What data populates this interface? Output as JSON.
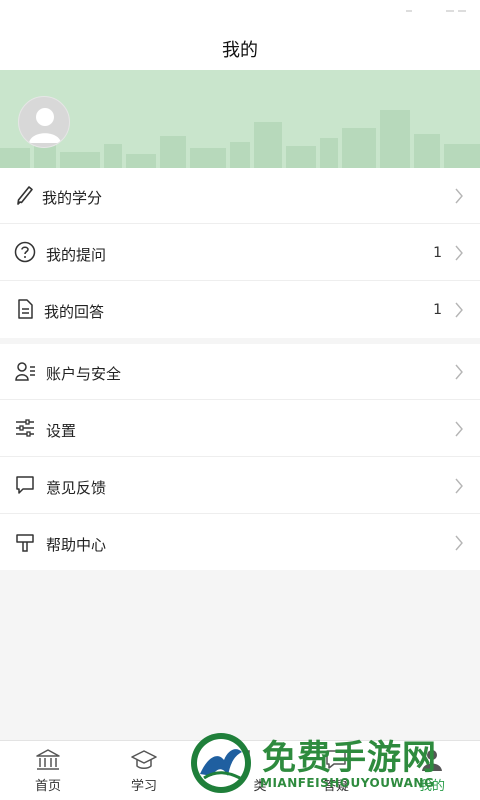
{
  "header": {
    "title": "我的"
  },
  "menu_group_1": [
    {
      "label": "我的学分",
      "icon": "pencil-icon",
      "count": ""
    },
    {
      "label": "我的提问",
      "icon": "question-circle-icon",
      "count": "1"
    },
    {
      "label": "我的回答",
      "icon": "document-icon",
      "count": "1"
    }
  ],
  "menu_group_2": [
    {
      "label": "账户与安全",
      "icon": "account-security-icon"
    },
    {
      "label": "设置",
      "icon": "sliders-icon"
    },
    {
      "label": "意见反馈",
      "icon": "feedback-bubble-icon"
    },
    {
      "label": "帮助中心",
      "icon": "signpost-icon"
    }
  ],
  "tabs": [
    {
      "label": "首页",
      "icon": "bank-icon"
    },
    {
      "label": "学习",
      "icon": "graduation-cap-icon"
    },
    {
      "label": "类",
      "icon": "category-icon"
    },
    {
      "label": "答疑",
      "icon": "qa-icon"
    },
    {
      "label": "我的",
      "icon": "user-icon"
    }
  ],
  "watermark": {
    "text": "免费手游网",
    "subtext": "MIANFEISHOUYOUWANG"
  },
  "colors": {
    "banner": "#c9e5cc",
    "accent": "#2a9d4a",
    "watermark": "#2e8b3e"
  }
}
